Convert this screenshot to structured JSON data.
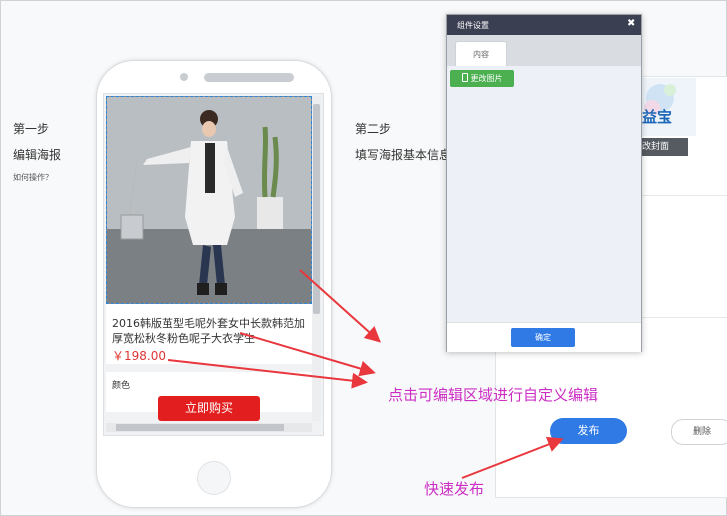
{
  "step1": {
    "title": "第一步",
    "subtitle": "编辑海报",
    "help": "如何操作？"
  },
  "step2": {
    "title": "第二步",
    "subtitle": "填写海报基本信息"
  },
  "product": {
    "title": "2016韩版茧型毛呢外套女中长款韩范加厚宽松秋冬粉色呢子大衣学生",
    "price": "￥198.00",
    "next_label": "颜色",
    "buy_label": "立即购买"
  },
  "dialog": {
    "title": "组件设置",
    "close_glyph": "✖",
    "tab_label": "内容",
    "change_image_label": "更改图片",
    "confirm_label": "确定"
  },
  "cover": {
    "logo_text": "益宝",
    "change_label": "改封面"
  },
  "actions": {
    "publish_label": "发布",
    "delete_label": "删除"
  },
  "annotations": {
    "edit_hint": "点击可编辑区域进行自定义编辑",
    "publish_hint": "快速发布"
  },
  "colors": {
    "annotation": "#cc2ec4",
    "arrow": "#e8373d",
    "primary": "#2f7ae5",
    "buy": "#e21e1e",
    "green": "#4caf50"
  }
}
